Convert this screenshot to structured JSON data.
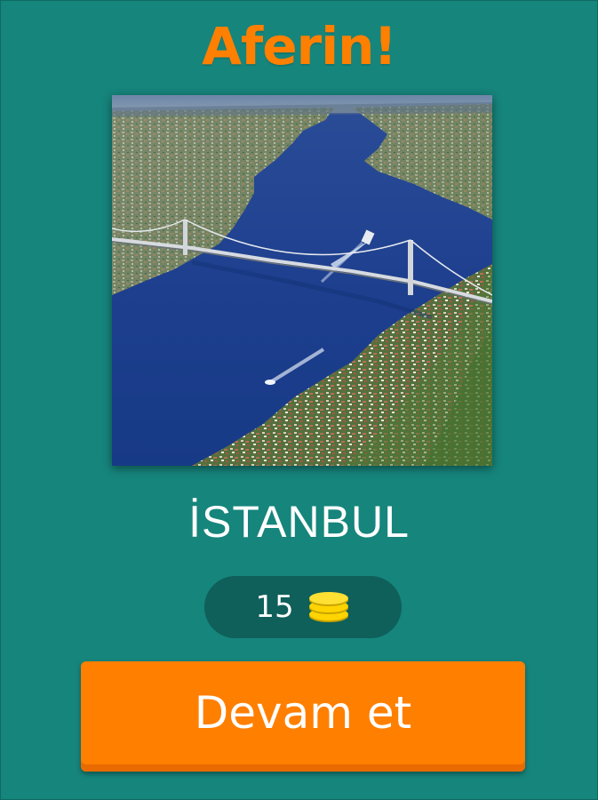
{
  "header": {
    "title": "Aferin!"
  },
  "question": {
    "image": "istanbul-bosphorus-bridge-aerial-photo",
    "answer": "İSTANBUL"
  },
  "reward": {
    "amount": "15",
    "icon": "coin-stack-icon"
  },
  "actions": {
    "continue_label": "Devam et"
  },
  "colors": {
    "background": "#16857c",
    "accent": "#ff7f00",
    "pill": "#0f5f5a",
    "coin": "#ffd400"
  }
}
